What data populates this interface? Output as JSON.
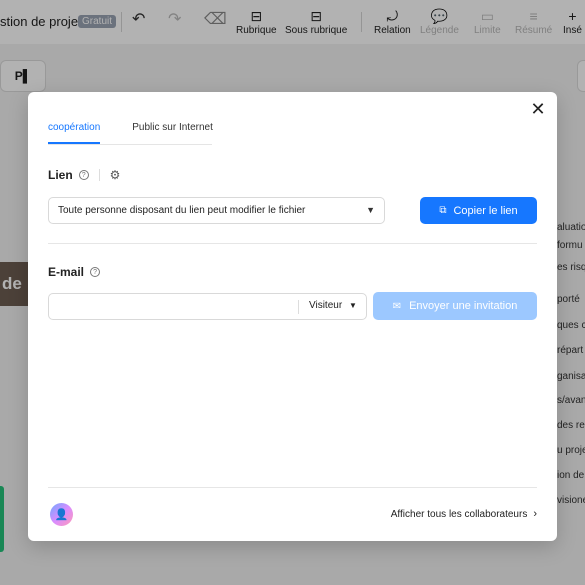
{
  "toolbar": {
    "title": "stion de projet",
    "badge": "Gratuit",
    "items": [
      {
        "label": "Rubrique",
        "icon": "⊟"
      },
      {
        "label": "Sous rubrique",
        "icon": "⊟"
      },
      {
        "label": "Relation",
        "icon": "⤾"
      },
      {
        "label": "Légende",
        "icon": "💬"
      },
      {
        "label": "Limite",
        "icon": "▭"
      },
      {
        "label": "Résumé",
        "icon": "≡"
      },
      {
        "label": "Insé",
        "icon": "+"
      }
    ]
  },
  "background": {
    "node_text": "de",
    "side_chip": "P▌",
    "right_texts": [
      "aluatio",
      "formu",
      "es risq",
      "porté",
      "ques c",
      "répart",
      "ganisa",
      "s/avan",
      "des re",
      "u proje",
      "ion de",
      "visione"
    ]
  },
  "modal": {
    "tabs": [
      "coopération",
      "Public sur Internet"
    ],
    "link_section": {
      "label": "Lien",
      "select_value": "Toute personne disposant du lien peut modifier le fichier",
      "copy_button": "Copier le lien"
    },
    "email_section": {
      "label": "E-mail",
      "email_value": "",
      "role": "Visiteur",
      "invite_button": "Envoyer une invitation"
    },
    "footer": {
      "collaborators_link": "Afficher tous les collaborateurs"
    }
  },
  "colors": {
    "accent": "#1677ff",
    "accent_disabled": "#9cc8ff"
  }
}
